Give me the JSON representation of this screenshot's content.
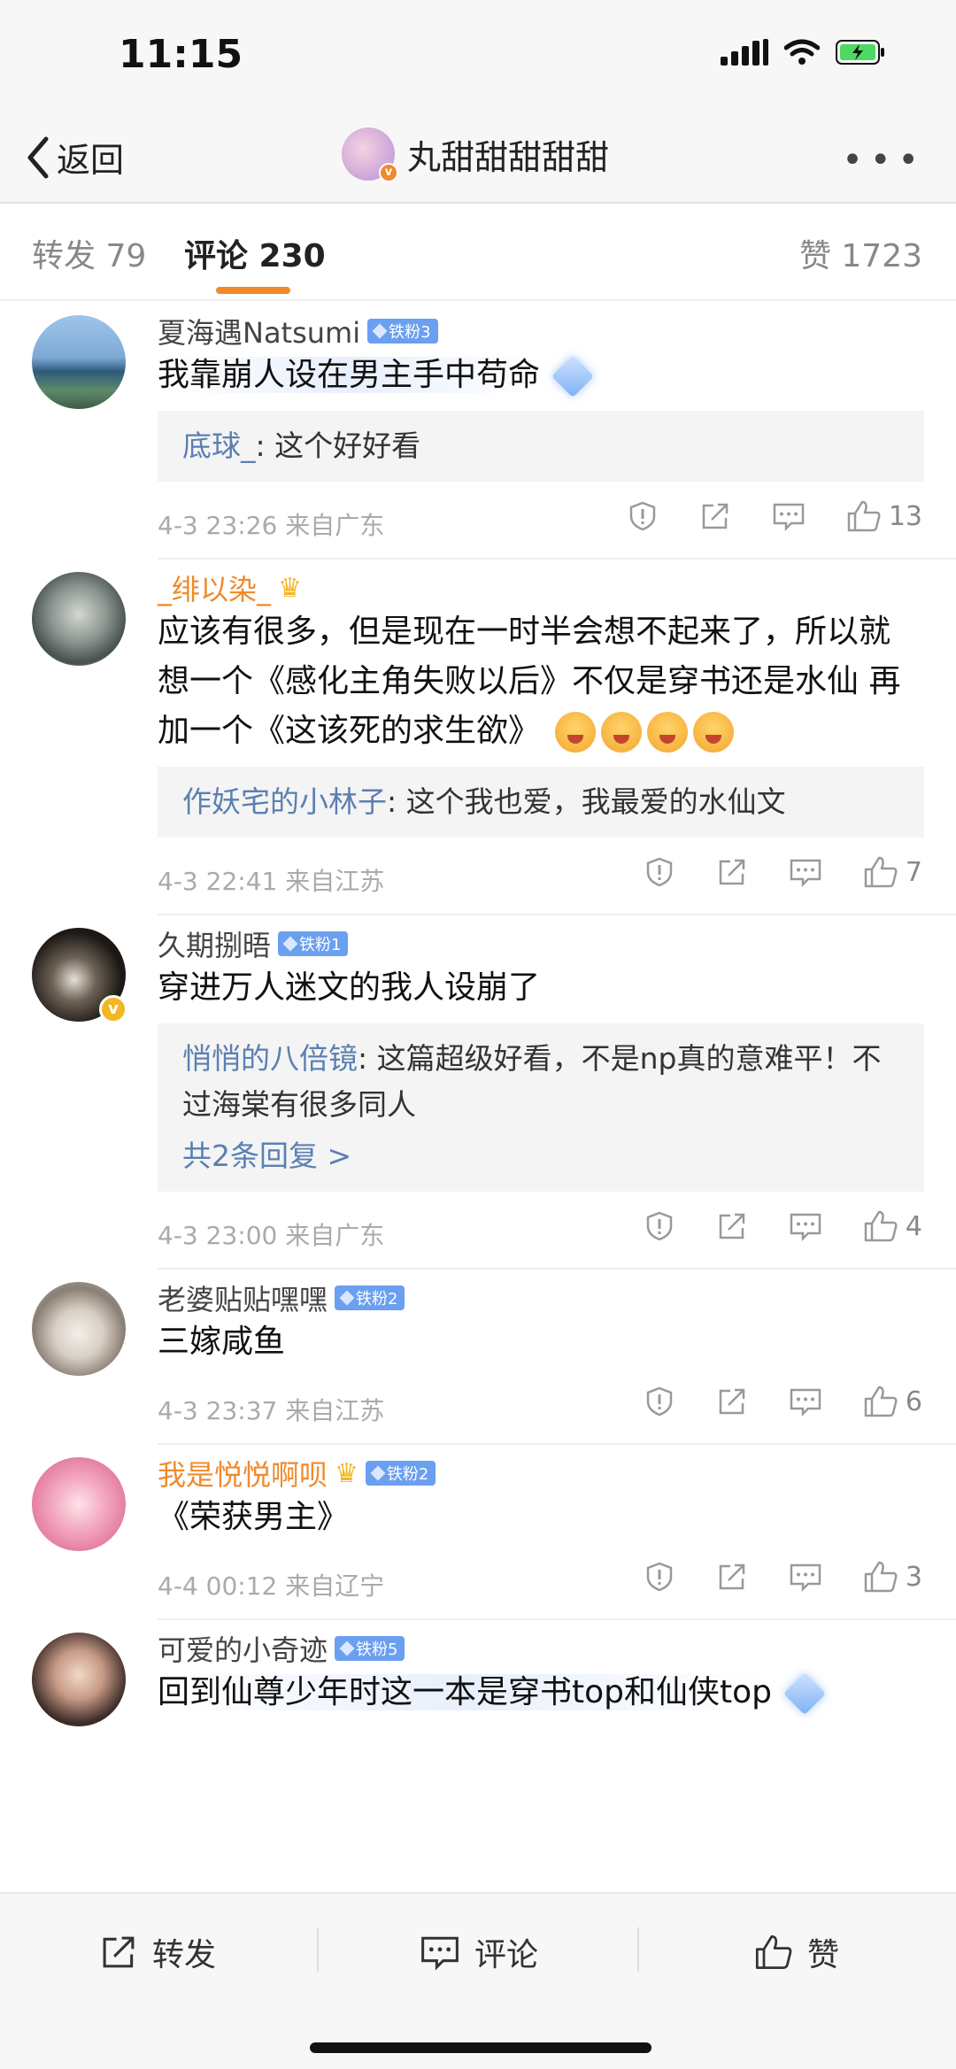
{
  "status_bar": {
    "time": "11:15"
  },
  "nav": {
    "back_label": "返回",
    "title": "丸甜甜甜甜甜"
  },
  "tabs": {
    "repost": "转发 79",
    "comment": "评论 230",
    "like": "赞 1723"
  },
  "comments": [
    {
      "user": "夏海遇Natsumi",
      "badge": "铁粉3",
      "text": "我靠崩人设在男主手中苟命",
      "reply_user": "底球_",
      "reply_text": ": 这个好好看",
      "time": "4-3 23:26 来自广东",
      "likes": "13"
    },
    {
      "user": "_绯以染_",
      "text": "应该有很多，但是现在一时半会想不起来了，所以就想一个《感化主角失败以后》不仅是穿书还是水仙 再加一个《这该死的求生欲》",
      "reply_user": "作妖宅的小林子",
      "reply_text": ": 这个我也爱，我最爱的水仙文",
      "time": "4-3 22:41 来自江苏",
      "likes": "7"
    },
    {
      "user": "久期捌晤",
      "badge": "铁粉1",
      "text": "穿进万人迷文的我人设崩了",
      "reply_user": "悄悄的八倍镜",
      "reply_text": ": 这篇超级好看，不是np真的意难平！不过海棠有很多同人",
      "more_replies": "共2条回复 >",
      "time": "4-3 23:00 来自广东",
      "likes": "4"
    },
    {
      "user": "老婆贴贴嘿嘿",
      "badge": "铁粉2",
      "text": "三嫁咸鱼",
      "time": "4-3 23:37 来自江苏",
      "likes": "6"
    },
    {
      "user": "我是悦悦啊呗",
      "badge": "铁粉2",
      "text": "《荣获男主》",
      "time": "4-4 00:12 来自辽宁",
      "likes": "3"
    },
    {
      "user": "可爱的小奇迹",
      "badge": "铁粉5",
      "text": "回到仙尊少年时这一本是穿书top和仙侠top"
    }
  ],
  "bottom_bar": {
    "repost": "转发",
    "comment": "评论",
    "like": "赞"
  },
  "colors": {
    "accent": "#f08a2c",
    "link": "#5b7fb2",
    "badge": "#6b9ff0"
  },
  "icons": [
    "back-chevron-icon",
    "more-dots-icon",
    "report-icon",
    "share-icon",
    "comment-icon",
    "like-icon",
    "signal-icon",
    "wifi-icon",
    "battery-icon"
  ]
}
